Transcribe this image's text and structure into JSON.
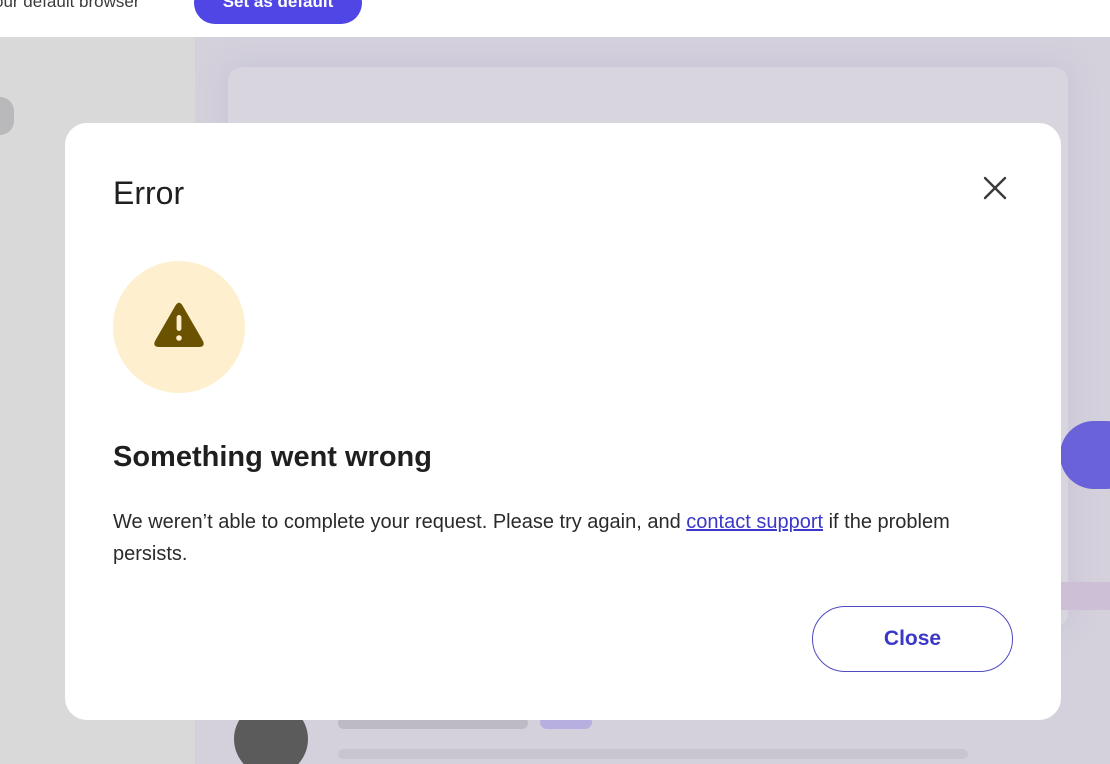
{
  "topbar": {
    "text": "our default browser",
    "set_default_label": "Set as default"
  },
  "dialog": {
    "title": "Error",
    "heading": "Something went wrong",
    "message_before_link": "We weren’t able to complete your request. Please try again, and ",
    "link_text": "contact support",
    "message_after_link": " if the problem persists.",
    "close_button_label": "Close"
  },
  "icons": {
    "close": "close-icon",
    "warning": "warning-triangle-icon"
  },
  "colors": {
    "accent": "#4f46e5",
    "link": "#3b37c8",
    "warning_bg": "#feefcf",
    "warning_icon": "#6b5200"
  }
}
